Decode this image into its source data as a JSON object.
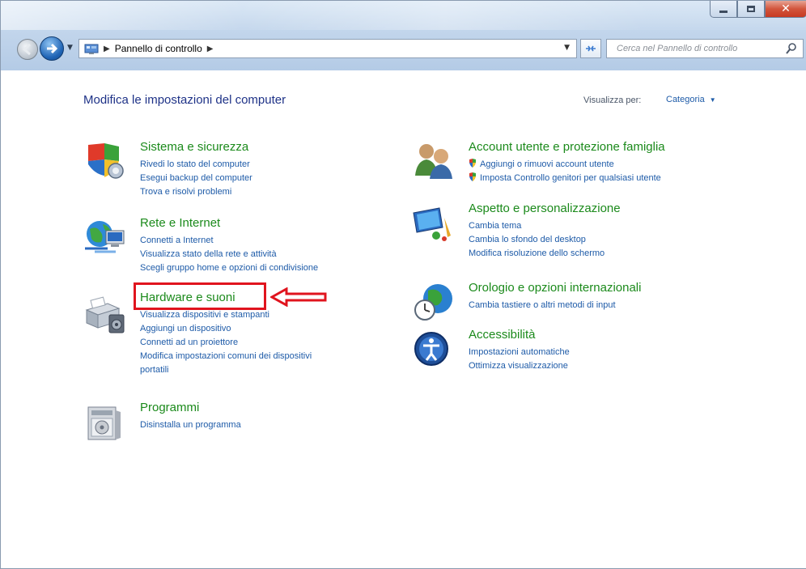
{
  "window": {
    "caption_buttons": [
      "minimize",
      "maximize",
      "close"
    ]
  },
  "navbar": {
    "breadcrumb": "Pannello di controllo",
    "search_placeholder": "Cerca nel Pannello di controllo"
  },
  "header": {
    "title": "Modifica le impostazioni del computer",
    "view_by_label": "Visualizza per:",
    "view_by_value": "Categoria"
  },
  "categories_left": [
    {
      "name": "sistema-sicurezza",
      "icon": "shield-icon",
      "title": "Sistema e sicurezza",
      "links": [
        "Rivedi lo stato del computer",
        "Esegui backup del computer",
        "Trova e risolvi problemi"
      ]
    },
    {
      "name": "rete-internet",
      "icon": "globe-network-icon",
      "title": "Rete e Internet",
      "links": [
        "Connetti a Internet",
        "Visualizza stato della rete e attività",
        "Scegli gruppo home e opzioni di condivisione"
      ]
    },
    {
      "name": "hardware-suoni",
      "icon": "printer-speaker-icon",
      "title": "Hardware e suoni",
      "links": [
        "Visualizza dispositivi e stampanti",
        "Aggiungi un dispositivo",
        "Connetti ad un proiettore",
        "Modifica impostazioni comuni dei dispositivi",
        "portatili"
      ]
    },
    {
      "name": "programmi",
      "icon": "programs-icon",
      "title": "Programmi",
      "links": [
        "Disinstalla un programma"
      ]
    }
  ],
  "categories_right": [
    {
      "name": "account-utente",
      "icon": "users-icon",
      "title": "Account utente e protezione famiglia",
      "links": [
        "Aggiungi o rimuovi account utente",
        "Imposta Controllo genitori per qualsiasi utente"
      ]
    },
    {
      "name": "aspetto",
      "icon": "monitor-paint-icon",
      "title": "Aspetto e personalizzazione",
      "links": [
        "Cambia tema",
        "Cambia lo sfondo del desktop",
        "Modifica risoluzione dello schermo"
      ]
    },
    {
      "name": "orologio",
      "icon": "clock-globe-icon",
      "title": "Orologio e opzioni internazionali",
      "links": [
        "Cambia tastiere o altri metodi di input"
      ]
    },
    {
      "name": "accessibilita",
      "icon": "accessibility-icon",
      "title": "Accessibilità",
      "links": [
        "Impostazioni automatiche",
        "Ottimizza visualizzazione"
      ]
    }
  ],
  "annotation": {
    "highlight_color": "#e0141e",
    "highlighted_item": "Hardware e suoni"
  },
  "colors": {
    "category_title": "#1b8a1b",
    "link": "#1e5ba8",
    "page_title": "#1e3287"
  }
}
